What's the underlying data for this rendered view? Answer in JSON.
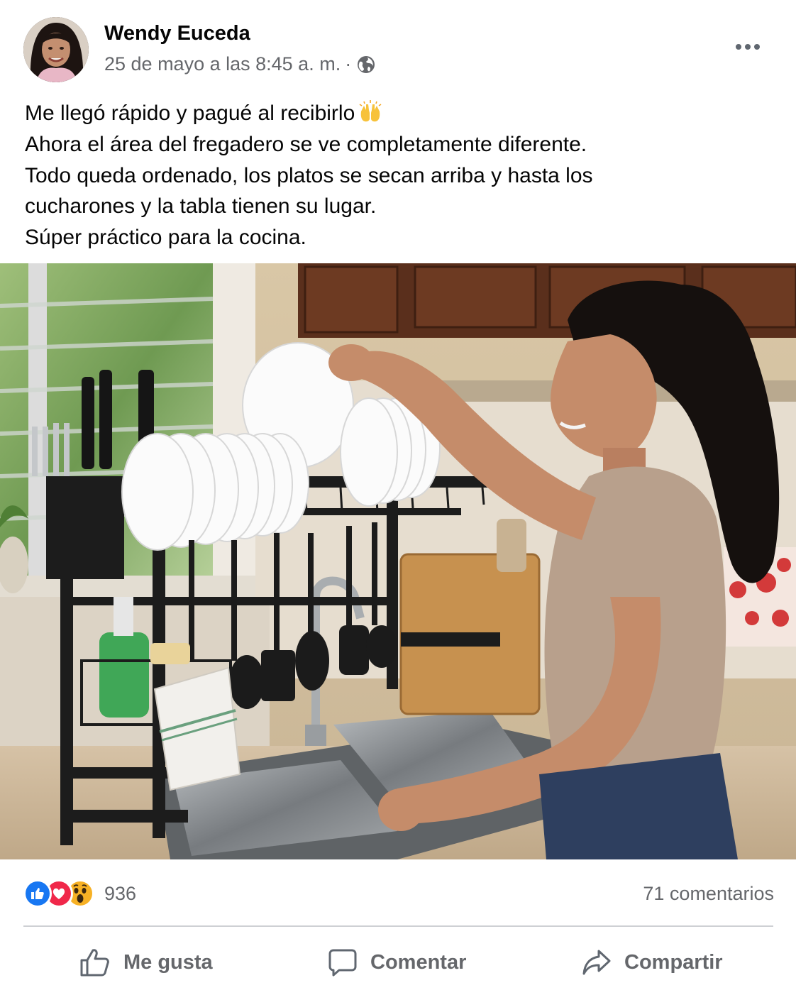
{
  "post": {
    "author": "Wendy Euceda",
    "timestamp": "25 de mayo a las 8:45 a. m.",
    "separator": "·",
    "privacy_icon": "globe-icon",
    "more_icon": "more-options-icon",
    "text_lines": [
      "Me llegó rápido y pagué al recibirlo",
      "Ahora el área del fregadero se ve completamente diferente.",
      "Todo queda ordenado, los platos se secan arriba y hasta los",
      "cucharones y la tabla tienen su lugar.",
      "Súper práctico para la cocina."
    ],
    "first_line_emoji": "raising-hands-emoji"
  },
  "reactions": {
    "icons": [
      "like-reaction-icon",
      "love-reaction-icon",
      "wow-reaction-icon"
    ],
    "count": "936",
    "comments": "71 comentarios"
  },
  "actions": {
    "like": "Me gusta",
    "comment": "Comentar",
    "share": "Compartir"
  },
  "colors": {
    "like_blue": "#1877f2",
    "love_red": "#f0284a",
    "wow_yellow": "#f7b125",
    "secondary_text": "#65676b"
  }
}
